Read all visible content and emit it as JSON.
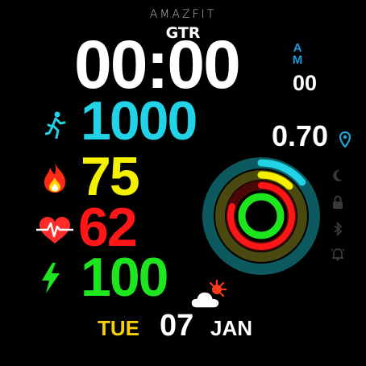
{
  "brand": "AMAZFIT",
  "model": "GTR",
  "time": {
    "hours": "00",
    "separator": ":",
    "minutes": "00",
    "ampm_top": "A",
    "ampm_bottom": "M",
    "seconds": "00"
  },
  "metrics": {
    "steps": "1000",
    "calories": "75",
    "heart_rate": "62",
    "battery": "100",
    "distance": "0.70"
  },
  "date": {
    "weekday": "TUE",
    "day": "07",
    "month": "JAN"
  },
  "icons": {
    "steps": "walking-person-icon",
    "calories": "flame-icon",
    "heart_rate": "heart-pulse-icon",
    "battery": "lightning-icon",
    "distance": "location-pin-icon",
    "weather": "partly-cloudy-icon",
    "status": [
      "moon-icon",
      "lock-icon",
      "bluetooth-icon",
      "alarm-icon"
    ]
  },
  "activity_rings": {
    "outer_progress": 0.14,
    "middle_progress": 0.12,
    "inner_progress": 0.8
  },
  "colors": {
    "steps": "#22d3e8",
    "calories": "#f4f000",
    "heart_rate": "#ff1616",
    "battery": "#1ee61e",
    "ampm": "#1e9bd7",
    "weekday": "#f4d000"
  }
}
